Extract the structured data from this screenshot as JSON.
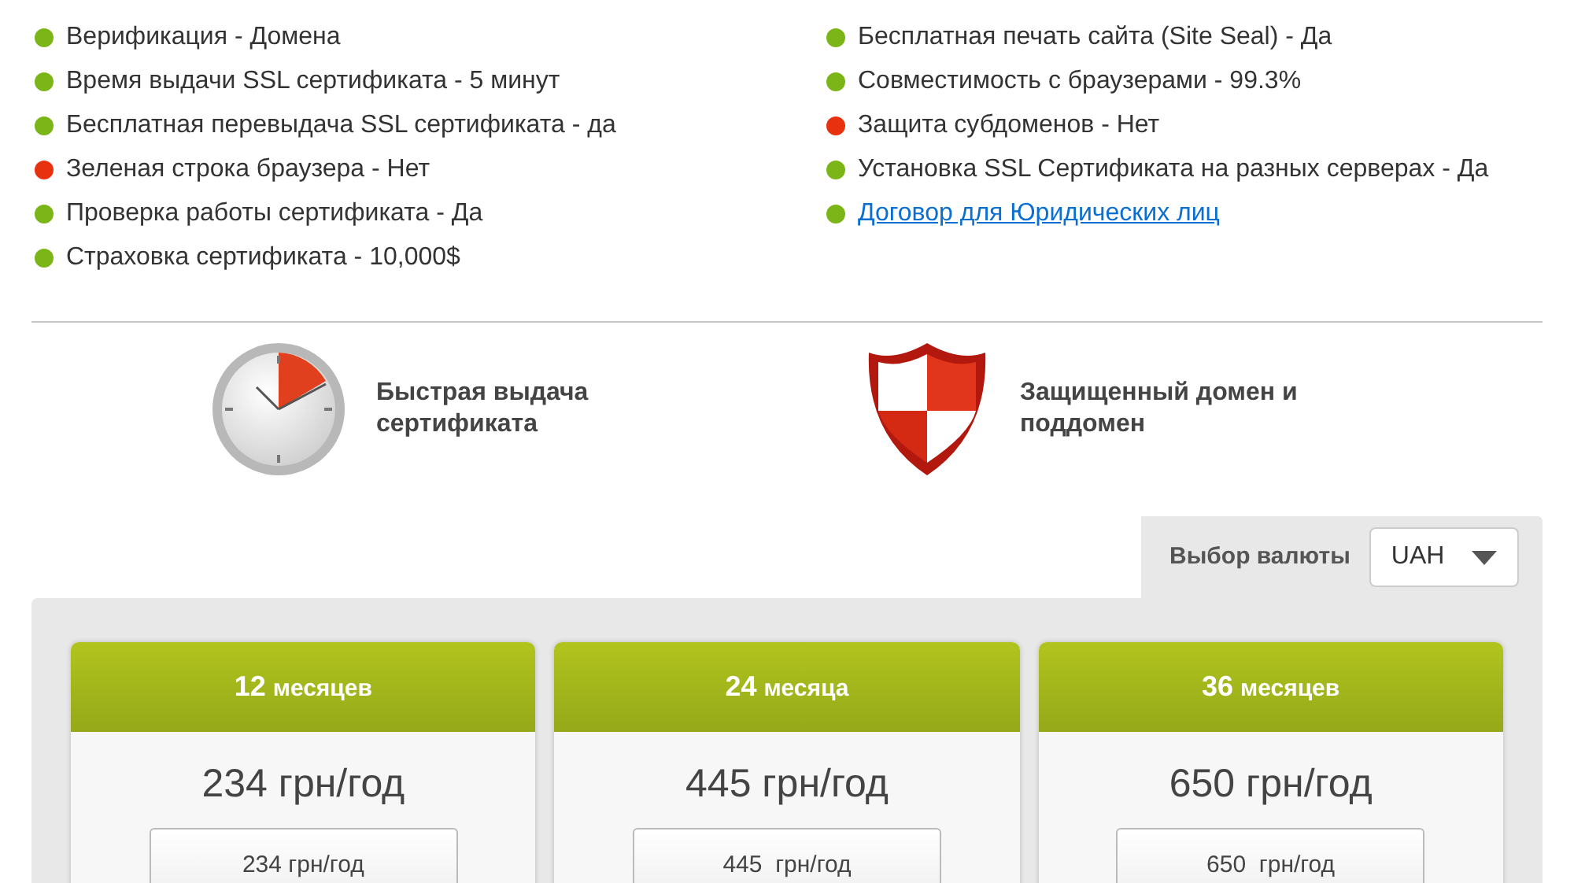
{
  "features_left": [
    {
      "kind": "text",
      "text": "Верификация - Домена",
      "ok": true
    },
    {
      "kind": "text",
      "text": "Время выдачи SSL сертификата - 5 минут",
      "ok": true
    },
    {
      "kind": "text",
      "text": "Бесплатная перевыдача SSL сертификата - да",
      "ok": true
    },
    {
      "kind": "text",
      "text": "Зеленая строка браузера - Нет",
      "ok": false
    },
    {
      "kind": "text",
      "text": "Проверка работы сертификата - Да",
      "ok": true
    },
    {
      "kind": "text",
      "text": "Страховка сертификата - 10,000$",
      "ok": true
    }
  ],
  "features_right": [
    {
      "kind": "text",
      "text": "Бесплатная печать сайта (Site Seal) - Да",
      "ok": true
    },
    {
      "kind": "text",
      "text": "Совместимость с браузерами - 99.3%",
      "ok": true
    },
    {
      "kind": "text",
      "text": "Защита субдоменов - Нет",
      "ok": false
    },
    {
      "kind": "text",
      "text": "Установка SSL Сертификата на разных серверах - Да",
      "ok": true
    },
    {
      "kind": "link",
      "text": "Договор для Юридических лиц",
      "ok": true
    }
  ],
  "highlights": [
    {
      "kind": "clock",
      "text": "Быстрая выдача сертификата"
    },
    {
      "kind": "shield",
      "text": "Защищенный домен и поддомен"
    }
  ],
  "currency": {
    "label": "Выбор валюты",
    "value": "UAH"
  },
  "plans": [
    {
      "term_number": "12",
      "term_unit": "месяцев",
      "price": "234 грн/год",
      "button": "234 грн/год"
    },
    {
      "term_number": "24",
      "term_unit": "месяца",
      "price": "445 грн/год",
      "button": "445  грн/год"
    },
    {
      "term_number": "36",
      "term_unit": "месяцев",
      "price": "650 грн/год",
      "button": "650  грн/год"
    }
  ]
}
